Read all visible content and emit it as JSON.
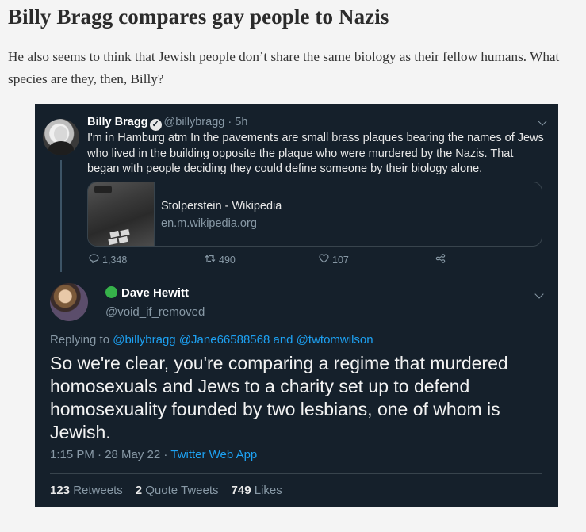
{
  "article": {
    "headline": "Billy Bragg compares gay people to Nazis",
    "intro": "He also seems to think that Jewish people don’t share the same biology as their fellow humans. What species are they, then, Billy?"
  },
  "tweet1": {
    "name": "Billy Bragg",
    "verified_glyph": "✓",
    "handle": "@billybragg",
    "separator": "·",
    "time": "5h",
    "text": "I'm in Hamburg atm In the pavements are small brass plaques bearing the names of Jews who lived in the building opposite the plaque who were murdered by the Nazis. That began with people deciding they could define someone by their biology alone.",
    "card": {
      "title": "Stolperstein - Wikipedia",
      "url": "en.m.wikipedia.org"
    },
    "actions": {
      "replies": "1,348",
      "retweets": "490",
      "likes": "107"
    },
    "icons": {
      "reply": "reply-icon",
      "retweet": "retweet-icon",
      "like": "heart-icon",
      "share": "share-icon"
    }
  },
  "tweet2": {
    "name": "Dave Hewitt",
    "handle": "@void_if_removed",
    "replying_prefix": "Replying to",
    "mentions": "@billybragg @Jane66588568 and @twtomwilson",
    "text": "So we're clear, you're comparing a regime that murdered homosexuals and Jews to a charity set up to defend homosexuality founded by two lesbians, one of whom is Jewish.",
    "time": "1:15 PM · 28 May 22 ·",
    "app": "Twitter Web App",
    "stats": {
      "retweets_count": "123",
      "retweets_label": "Retweets",
      "quotes_count": "2",
      "quotes_label": "Quote Tweets",
      "likes_count": "749",
      "likes_label": "Likes"
    },
    "status_color": "#36b24a"
  },
  "colors": {
    "dark_bg": "#15202b",
    "link": "#1da1f2",
    "muted": "#8899a6"
  }
}
